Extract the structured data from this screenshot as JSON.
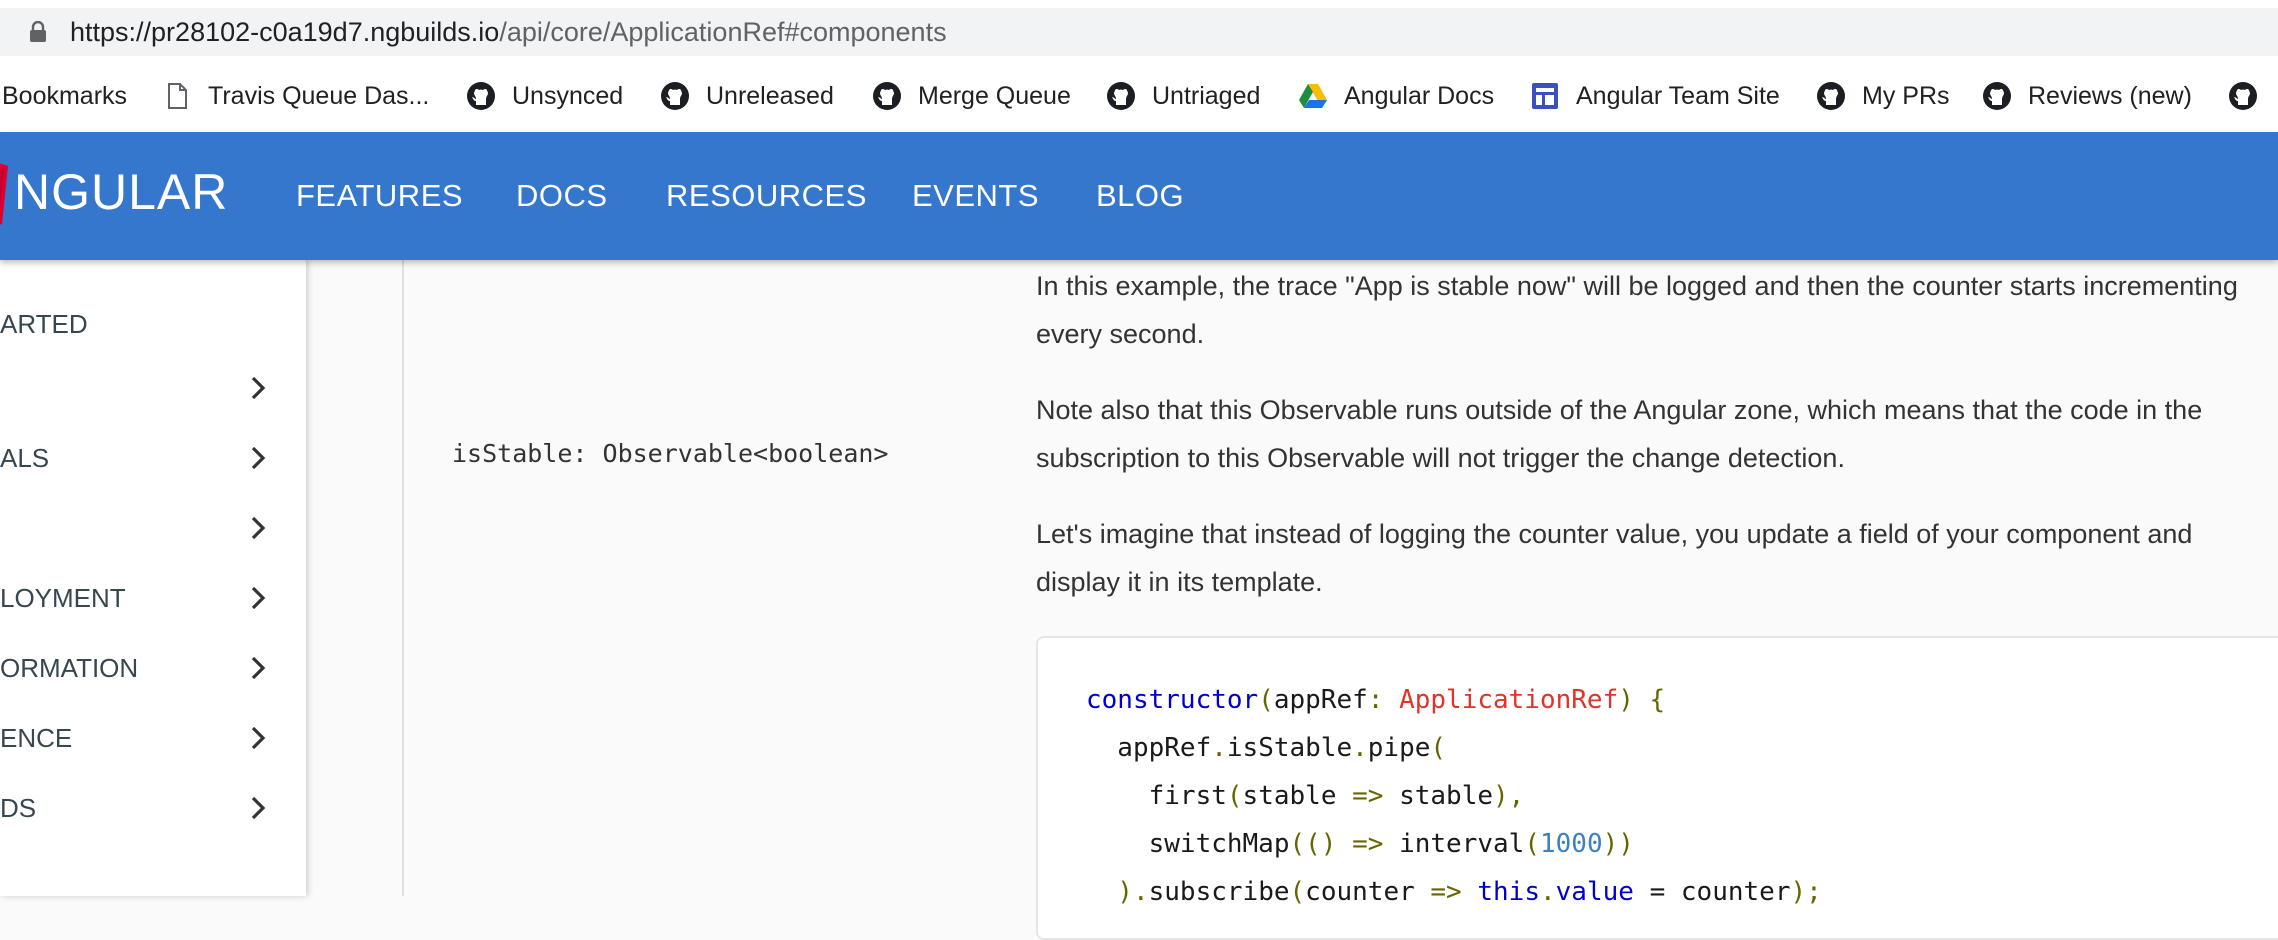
{
  "browser": {
    "url_host": "https://pr28102-c0a19d7.ngbuilds.io",
    "url_path": "/api/core/ApplicationRef#components"
  },
  "bookmarks": [
    {
      "label": "Bookmarks",
      "icon": "none"
    },
    {
      "label": "Travis Queue Das...",
      "icon": "page-icon"
    },
    {
      "label": "Unsynced",
      "icon": "github-icon"
    },
    {
      "label": "Unreleased",
      "icon": "github-icon"
    },
    {
      "label": "Merge Queue",
      "icon": "github-icon"
    },
    {
      "label": "Untriaged",
      "icon": "github-icon"
    },
    {
      "label": "Angular Docs",
      "icon": "drive-icon"
    },
    {
      "label": "Angular Team Site",
      "icon": "sites-icon"
    },
    {
      "label": "My PRs",
      "icon": "github-icon"
    },
    {
      "label": "Reviews (new)",
      "icon": "github-icon"
    }
  ],
  "topnav": {
    "logo": "NGULAR",
    "links": [
      "FEATURES",
      "DOCS",
      "RESOURCES",
      "EVENTS",
      "BLOG"
    ],
    "background": "#3477cc"
  },
  "sidebar": {
    "items": [
      {
        "label": "ARTED",
        "chevron": false
      },
      {
        "label": "",
        "chevron": true
      },
      {
        "label": "ALS",
        "chevron": true
      },
      {
        "label": "",
        "chevron": true
      },
      {
        "label": "LOYMENT",
        "chevron": true
      },
      {
        "label": "ORMATION",
        "chevron": true
      },
      {
        "label": "ENCE",
        "chevron": true
      },
      {
        "label": "DS",
        "chevron": true
      }
    ]
  },
  "content": {
    "member": "isStable: Observable<boolean>",
    "paragraphs": [
      [
        "In this example, the trace \"App is stable now\" will be logged and then the counter starts incrementing",
        "every second."
      ],
      [
        "Note also that this Observable runs outside of the Angular zone, which means that the code in the",
        "subscription to this Observable will not trigger the change detection."
      ],
      [
        "Let's imagine that instead of logging the counter value, you update a field of your component and",
        "display it in its template."
      ]
    ],
    "code": {
      "l1_kw": "constructor",
      "l1_a": "(",
      "l1_b": "appRef",
      "l1_c": ": ",
      "l1_type": "ApplicationRef",
      "l1_d": ") {",
      "l2_a": "  appRef",
      "l2_b": ".",
      "l2_c": "isStable",
      "l2_d": ".",
      "l2_e": "pipe",
      "l2_f": "(",
      "l3_a": "    first",
      "l3_b": "(",
      "l3_c": "stable ",
      "l3_d": "=>",
      "l3_e": " stable",
      "l3_f": "),",
      "l4_a": "    switchMap",
      "l4_b": "(() ",
      "l4_c": "=>",
      "l4_d": " interval",
      "l4_e": "(",
      "l4_num": "1000",
      "l4_f": "))",
      "l5_a": "  ).",
      "l5_b": "subscribe",
      "l5_c": "(",
      "l5_d": "counter ",
      "l5_e": "=>",
      "l5_f": " ",
      "l5_kw": "this",
      "l5_g": ".",
      "l5_h": "value",
      "l5_i": " = counter",
      "l5_j": ");"
    }
  }
}
